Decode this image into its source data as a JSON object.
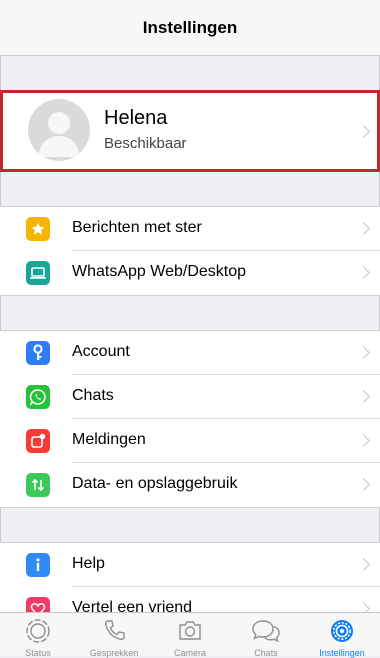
{
  "header": {
    "title": "Instellingen"
  },
  "profile": {
    "name": "Helena",
    "status": "Beschikbaar"
  },
  "groups": {
    "starred": [
      {
        "label": "Berichten met ster",
        "icon": "star-icon",
        "color": "#f7b500"
      },
      {
        "label": "WhatsApp Web/Desktop",
        "icon": "laptop-icon",
        "color": "#1aa597"
      }
    ],
    "settings": [
      {
        "label": "Account",
        "icon": "key-icon",
        "color": "#2f7df6"
      },
      {
        "label": "Chats",
        "icon": "whatsapp-icon",
        "color": "#25c23c"
      },
      {
        "label": "Meldingen",
        "icon": "notification-icon",
        "color": "#f23c34"
      },
      {
        "label": "Data- en opslaggebruik",
        "icon": "data-arrows-icon",
        "color": "#3cc85a"
      }
    ],
    "help": [
      {
        "label": "Help",
        "icon": "info-icon",
        "color": "#2f8cf6"
      },
      {
        "label": "Vertel een vriend",
        "icon": "heart-icon",
        "color": "#f03c64"
      }
    ]
  },
  "tabbar": {
    "tabs": [
      {
        "label": "Status",
        "icon": "status-icon"
      },
      {
        "label": "Gesprekken",
        "icon": "phone-icon"
      },
      {
        "label": "Camera",
        "icon": "camera-icon"
      },
      {
        "label": "Chats",
        "icon": "chat-bubbles-icon"
      },
      {
        "label": "Instellingen",
        "icon": "settings-gear-icon",
        "active": true
      }
    ],
    "active_color": "#0a7cff"
  }
}
